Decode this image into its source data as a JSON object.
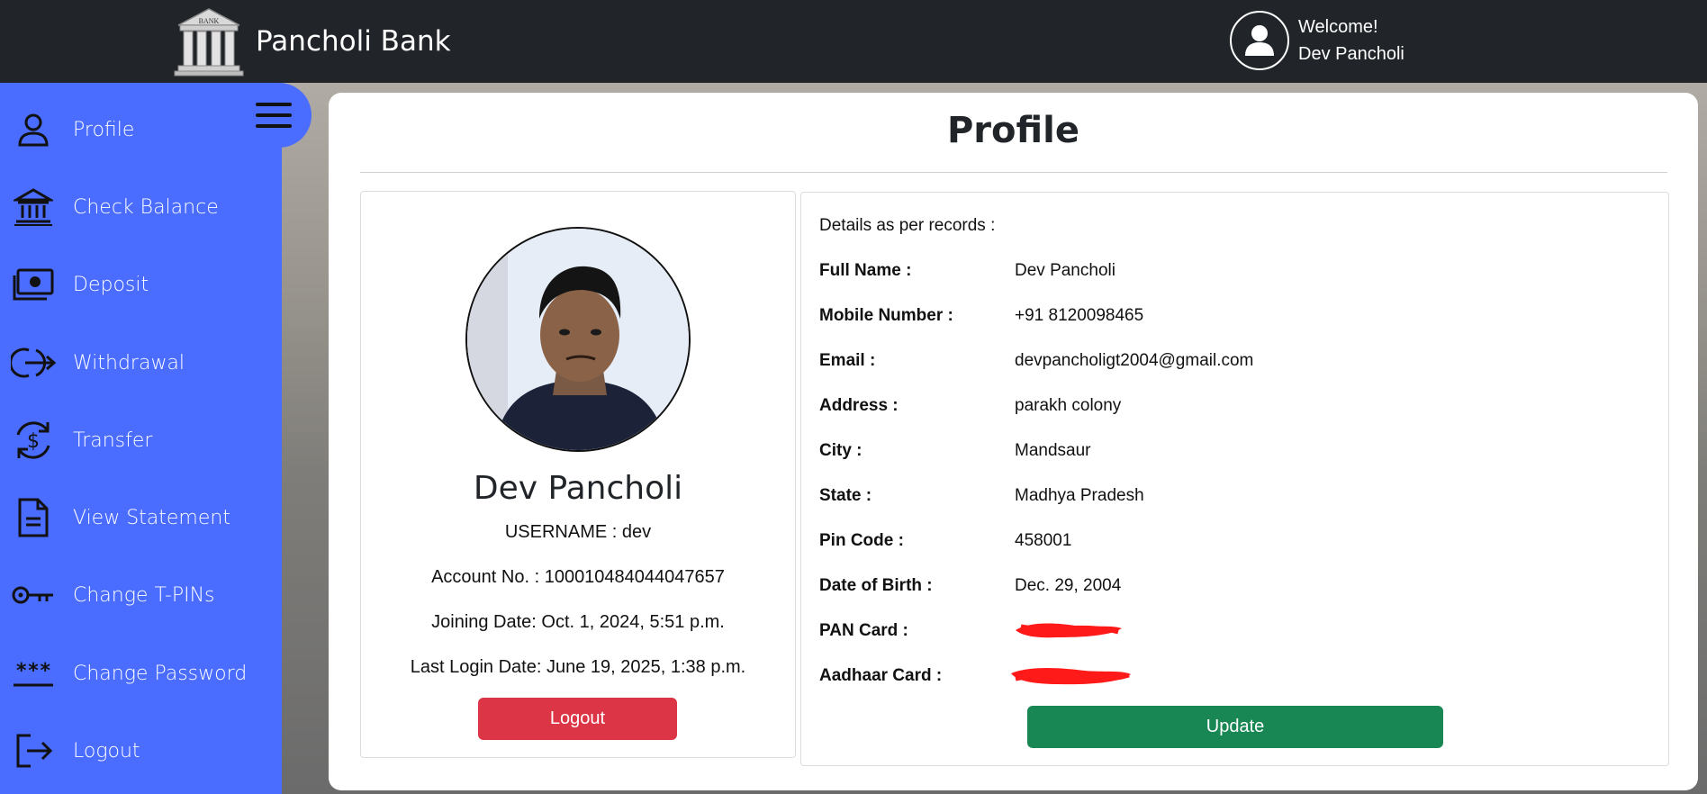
{
  "navbar": {
    "brand_logo_text": "BANK",
    "brand_name": "Pancholi Bank",
    "welcome_line1": "Welcome!",
    "welcome_line2": "Dev Pancholi"
  },
  "sidebar": {
    "items": [
      {
        "label": "Profile",
        "icon": "person-icon"
      },
      {
        "label": "Check Balance",
        "icon": "bank-icon"
      },
      {
        "label": "Deposit",
        "icon": "cash-icon"
      },
      {
        "label": "Withdrawal",
        "icon": "withdraw-icon"
      },
      {
        "label": "Transfer",
        "icon": "transfer-icon"
      },
      {
        "label": "View Statement",
        "icon": "document-icon"
      },
      {
        "label": "Change T-PINs",
        "icon": "key-icon"
      },
      {
        "label": "Change Password",
        "icon": "password-icon"
      },
      {
        "label": "Logout",
        "icon": "logout-icon"
      }
    ]
  },
  "main": {
    "title": "Profile",
    "profile": {
      "name": "Dev Pancholi",
      "username": "USERNAME : dev",
      "account_no": "Account No. : 100010484044047657",
      "joining_date": "Joining Date: Oct. 1, 2024, 5:51 p.m.",
      "last_login": "Last Login Date: June 19, 2025, 1:38 p.m.",
      "logout_label": "Logout"
    },
    "details": {
      "heading": "Details as per records :",
      "rows": [
        {
          "label": "Full Name :",
          "value": "Dev Pancholi"
        },
        {
          "label": "Mobile Number :",
          "value": "+91 8120098465"
        },
        {
          "label": "Email :",
          "value": "devpancholigt2004@gmail.com"
        },
        {
          "label": "Address :",
          "value": "parakh colony"
        },
        {
          "label": "City :",
          "value": "Mandsaur"
        },
        {
          "label": "State :",
          "value": "Madhya Pradesh"
        },
        {
          "label": "Pin Code :",
          "value": "458001"
        },
        {
          "label": "Date of Birth :",
          "value": "Dec. 29, 2004"
        },
        {
          "label": "PAN Card :",
          "value": ""
        },
        {
          "label": "Aadhaar Card :",
          "value": ""
        }
      ],
      "update_label": "Update"
    }
  },
  "colors": {
    "navbar": "#212529",
    "sidebar": "#4a6cff",
    "logout_button": "#dc3545",
    "update_button": "#198754",
    "redaction": "#ff0000"
  }
}
